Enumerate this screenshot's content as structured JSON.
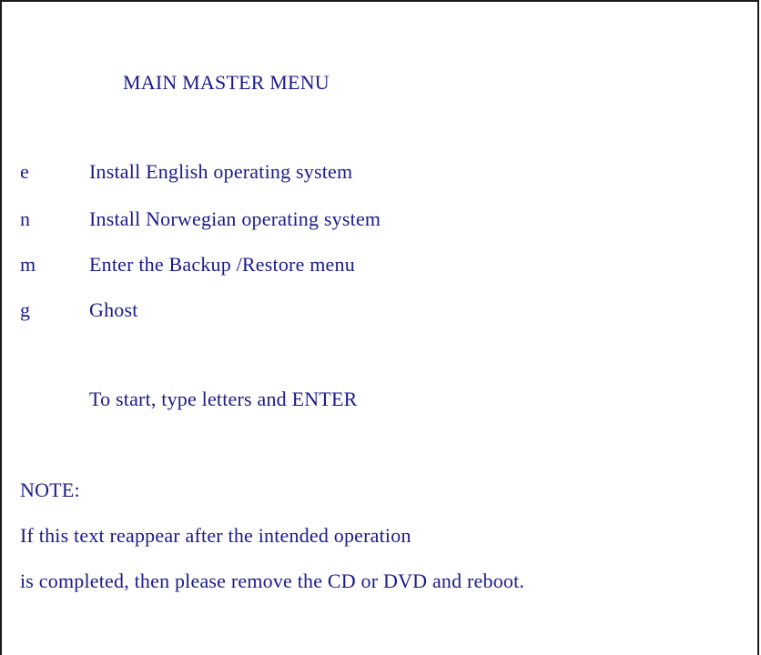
{
  "menu": {
    "title": "MAIN MASTER MENU",
    "items": [
      {
        "key": "e",
        "label": "Install English operating system"
      },
      {
        "key": "n",
        "label": "Install Norwegian operating system"
      },
      {
        "key": "m",
        "label": "Enter the Backup /Restore menu"
      },
      {
        "key": "g",
        "label": "Ghost"
      }
    ],
    "instruction": "To start, type letters and ENTER"
  },
  "note": {
    "heading": "NOTE:",
    "lines": [
      "If this text reappear after the intended operation",
      "is completed, then please remove the CD or DVD and reboot."
    ]
  },
  "colors": {
    "text": "#1a1a8c",
    "border": "#1a1a1a",
    "background": "#ffffff"
  }
}
